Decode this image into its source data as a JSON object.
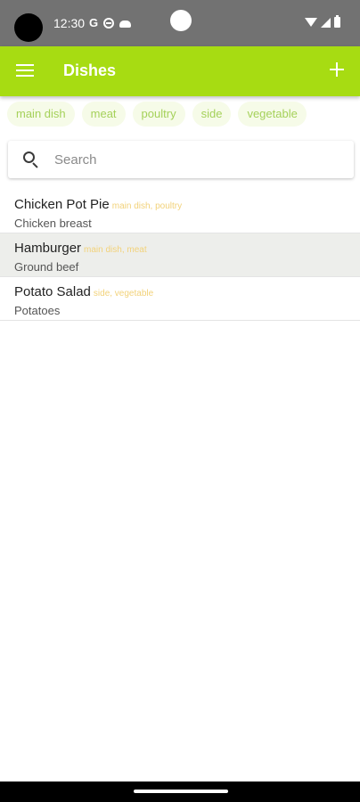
{
  "status_bar": {
    "time": "12:30",
    "notification_icons": [
      "G",
      "do-not-disturb-icon",
      "cloud-icon"
    ],
    "system_icons": [
      "wifi-icon",
      "signal-icon",
      "battery-icon"
    ]
  },
  "app_bar": {
    "title": "Dishes",
    "menu_icon": "menu-icon",
    "action_icon": "add-icon"
  },
  "chips": [
    {
      "label": "main dish"
    },
    {
      "label": "meat"
    },
    {
      "label": "poultry"
    },
    {
      "label": "side"
    },
    {
      "label": "vegetable"
    }
  ],
  "search": {
    "placeholder": "Search",
    "value": ""
  },
  "dishes": [
    {
      "name": "Chicken Pot Pie",
      "tags": "main dish, poultry",
      "ingredient": "Chicken breast",
      "selected": false
    },
    {
      "name": "Hamburger",
      "tags": "main dish, meat",
      "ingredient": "Ground beef",
      "selected": true
    },
    {
      "name": "Potato Salad",
      "tags": "side, vegetable",
      "ingredient": "Potatoes",
      "selected": false
    }
  ],
  "colors": {
    "app_bar": "#a7dc12",
    "status_bar": "#727272",
    "chip_bg": "#f6fbe8",
    "chip_text": "#a5d15a",
    "tag_text": "#f2d27a",
    "selected_row": "#edeeeb"
  }
}
